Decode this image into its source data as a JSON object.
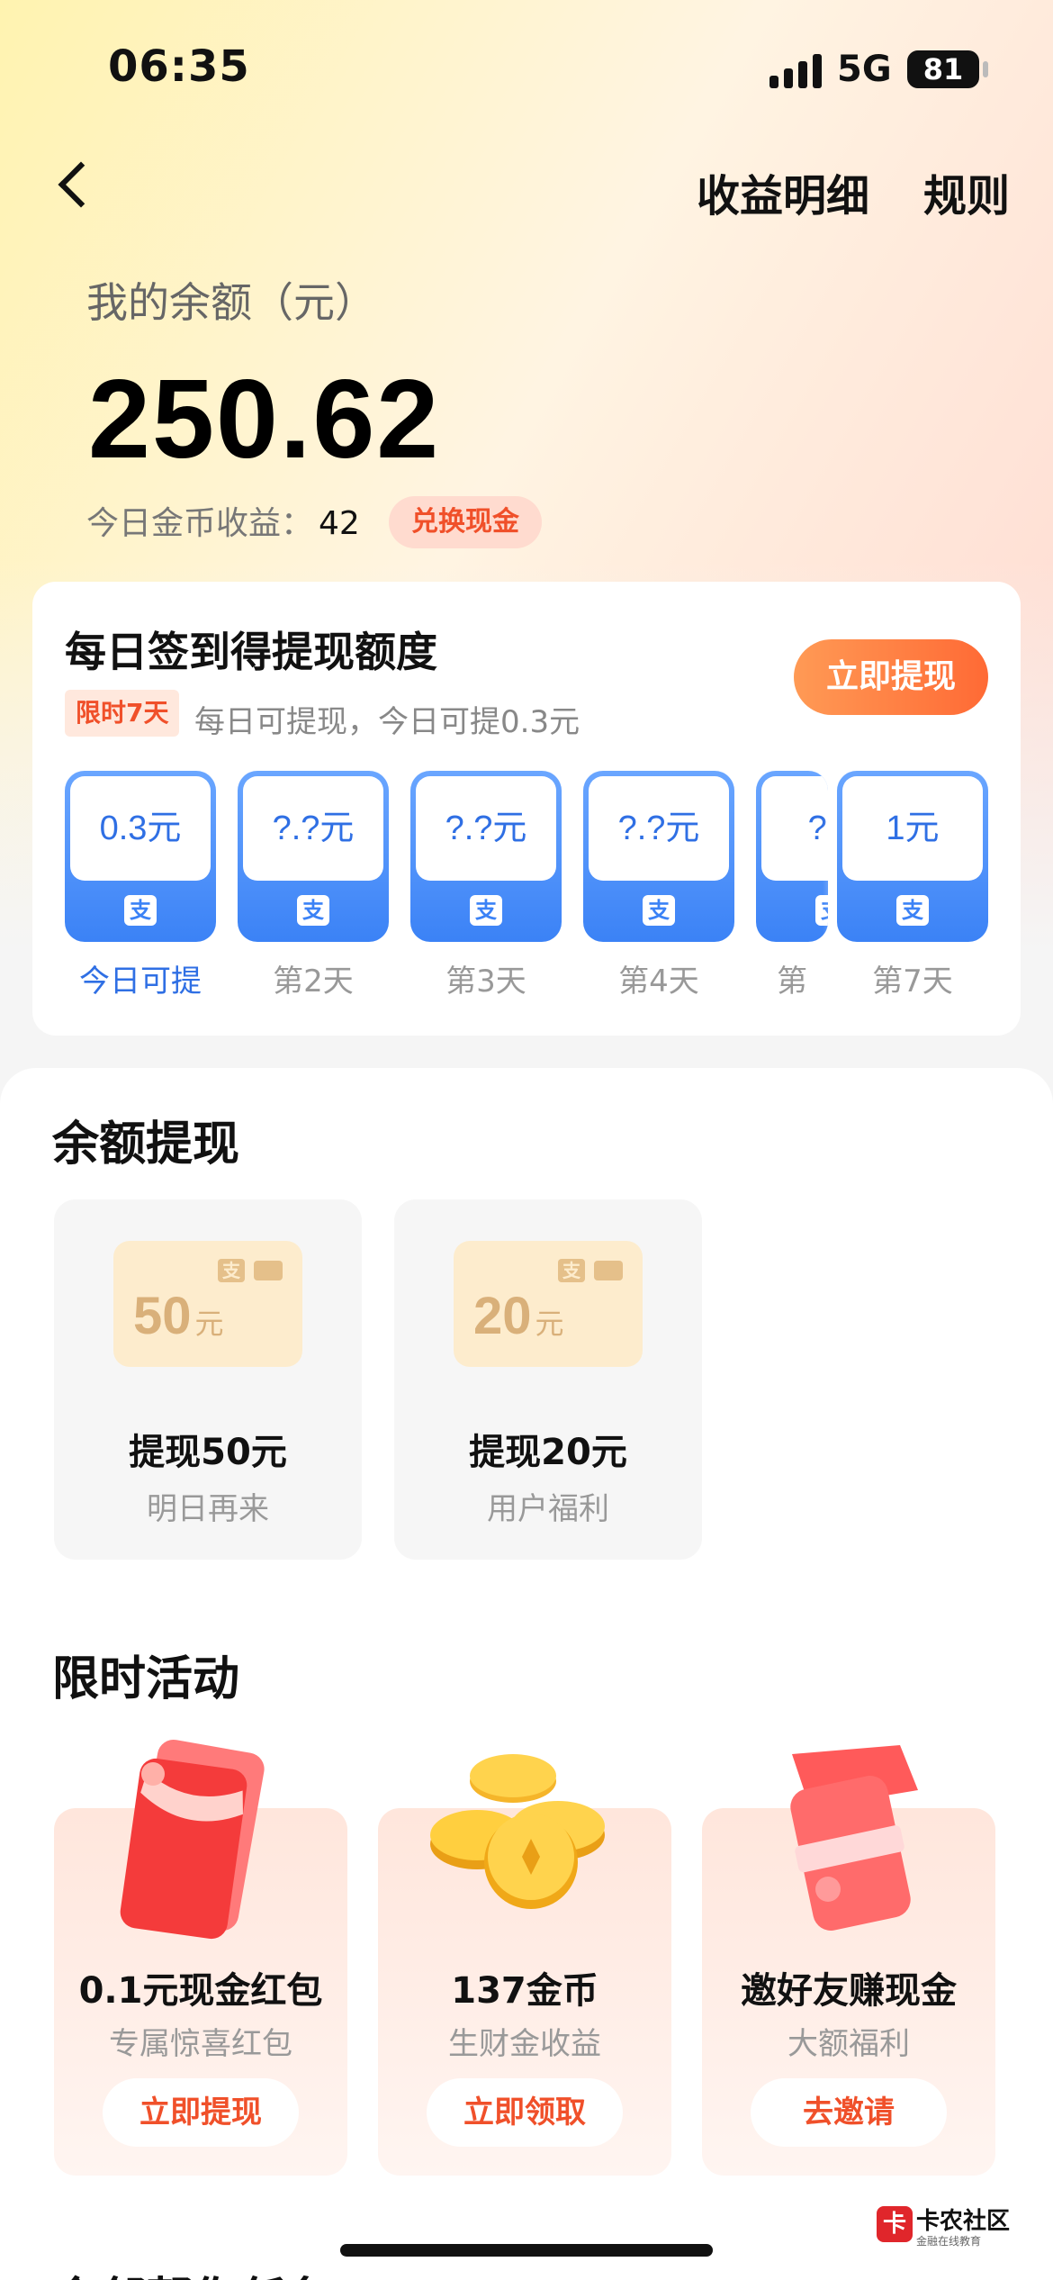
{
  "status": {
    "time": "06:35",
    "network": "5G",
    "battery": "81"
  },
  "nav": {
    "detail": "收益明细",
    "rules": "规则"
  },
  "balance": {
    "label": "我的余额（元）",
    "value": "250.62",
    "coin_label": "今日金币收益：",
    "coin_value": "42",
    "exchange": "兑换现金"
  },
  "sign_in": {
    "title": "每日签到得提现额度",
    "tag": "限时7天",
    "subtitle": "每日可提现，今日可提0.3元",
    "button": "立即提现",
    "days": [
      {
        "amount": "0.3元",
        "label": "今日可提",
        "pay_icon": "支"
      },
      {
        "amount": "?.?元",
        "label": "第2天",
        "pay_icon": "支"
      },
      {
        "amount": "?.?元",
        "label": "第3天",
        "pay_icon": "支"
      },
      {
        "amount": "?.?元",
        "label": "第4天",
        "pay_icon": "支"
      },
      {
        "amount": "?.?",
        "label": "第",
        "pay_icon": "支"
      },
      {
        "amount": "1元",
        "label": "第7天",
        "pay_icon": "支"
      }
    ]
  },
  "withdraw": {
    "title": "余额提现",
    "options": [
      {
        "amount": "50",
        "unit": "元",
        "title": "提现50元",
        "sub": "明日再来",
        "icon": "支"
      },
      {
        "amount": "20",
        "unit": "元",
        "title": "提现20元",
        "sub": "用户福利",
        "icon": "支"
      }
    ]
  },
  "activities": {
    "title": "限时活动",
    "items": [
      {
        "title": "0.1元现金红包",
        "sub": "专属惊喜红包",
        "button": "立即提现",
        "icon": "red-envelope-icon"
      },
      {
        "title": "137金币",
        "sub": "生财金收益",
        "button": "立即领取",
        "icon": "gold-coins-icon"
      },
      {
        "title": "邀好友赚现金",
        "sub": "大额福利",
        "button": "去邀请",
        "icon": "invite-cash-icon"
      }
    ]
  },
  "watermark": {
    "logo": "卡",
    "text": "卡农社区",
    "sub": "金融在线教育"
  },
  "peek_title": "今邻帮你任务",
  "colors": {
    "accent": "#f0502a",
    "blue": "#3b82f6",
    "gold": "#d9b07a"
  }
}
